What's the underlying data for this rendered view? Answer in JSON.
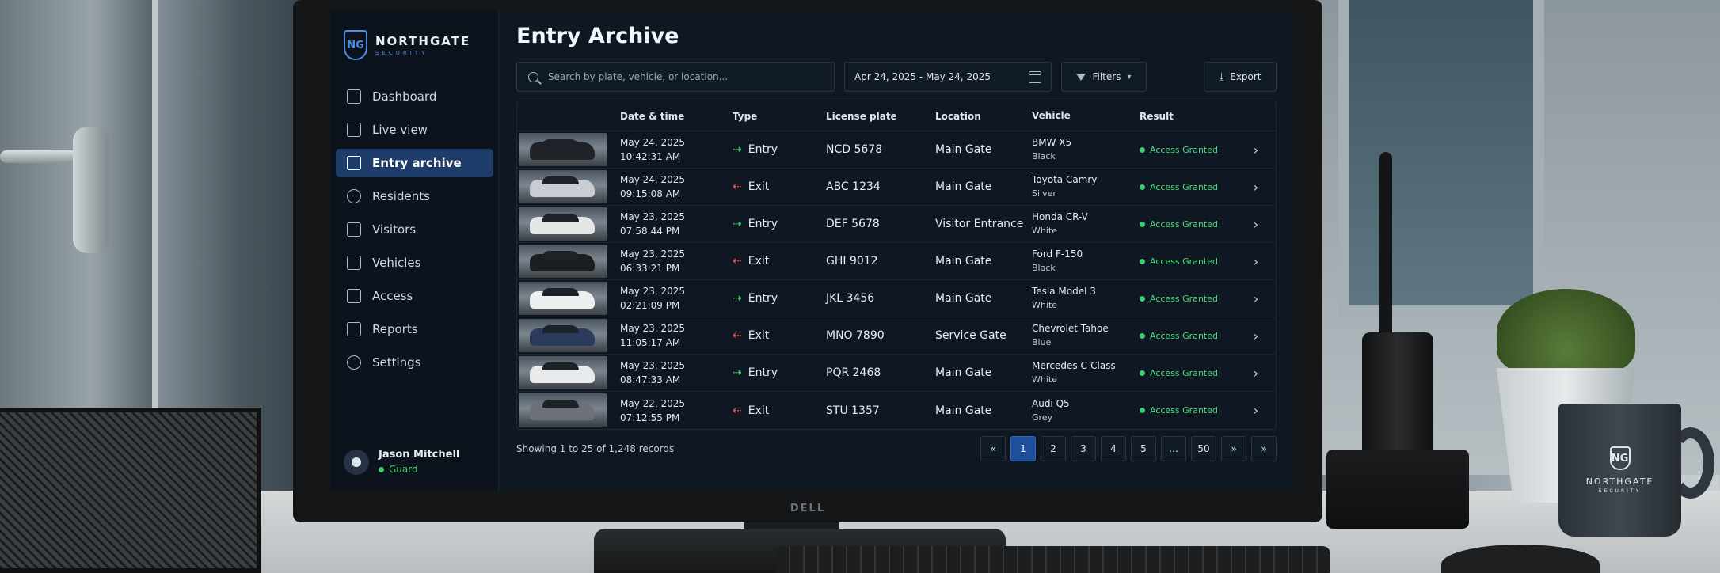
{
  "brand": {
    "name": "NORTHGATE",
    "sub": "SECURITY",
    "mark": "NG"
  },
  "page_title": "Entry Archive",
  "sidebar": {
    "items": [
      {
        "label": "Dashboard",
        "icon": "dashboard-icon",
        "active": false
      },
      {
        "label": "Live view",
        "icon": "camera-icon",
        "active": false
      },
      {
        "label": "Entry archive",
        "icon": "archive-icon",
        "active": true
      },
      {
        "label": "Residents",
        "icon": "person-icon",
        "active": false
      },
      {
        "label": "Visitors",
        "icon": "visitors-icon",
        "active": false
      },
      {
        "label": "Vehicles",
        "icon": "vehicle-icon",
        "active": false
      },
      {
        "label": "Access",
        "icon": "access-icon",
        "active": false
      },
      {
        "label": "Reports",
        "icon": "reports-icon",
        "active": false
      },
      {
        "label": "Settings",
        "icon": "gear-icon",
        "active": false
      }
    ]
  },
  "user": {
    "name": "Jason Mitchell",
    "role": "Guard"
  },
  "search": {
    "placeholder": "Search by plate, vehicle, or location..."
  },
  "date_range": "Apr 24, 2025 - May 24, 2025",
  "filters_label": "Filters",
  "export_label": "Export",
  "columns": {
    "datetime": "Date & time",
    "type": "Type",
    "plate": "License plate",
    "location": "Location",
    "vehicle": "Vehicle",
    "result": "Result"
  },
  "rows": [
    {
      "date": "May 24, 2025",
      "time": "10:42:31 AM",
      "type": "Entry",
      "plate": "NCD 5678",
      "location": "Main Gate",
      "vehicle": "BMW X5",
      "color": "Black",
      "result": "Access Granted",
      "car_color": "#1f2226"
    },
    {
      "date": "May 24, 2025",
      "time": "09:15:08 AM",
      "type": "Exit",
      "plate": "ABC 1234",
      "location": "Main Gate",
      "vehicle": "Toyota Camry",
      "color": "Silver",
      "result": "Access Granted",
      "car_color": "#c9cdd1"
    },
    {
      "date": "May 23, 2025",
      "time": "07:58:44 PM",
      "type": "Entry",
      "plate": "DEF 5678",
      "location": "Visitor Entrance",
      "vehicle": "Honda CR-V",
      "color": "White",
      "result": "Access Granted",
      "car_color": "#e4e6e8"
    },
    {
      "date": "May 23, 2025",
      "time": "06:33:21 PM",
      "type": "Exit",
      "plate": "GHI 9012",
      "location": "Main Gate",
      "vehicle": "Ford F-150",
      "color": "Black",
      "result": "Access Granted",
      "car_color": "#1c1e21"
    },
    {
      "date": "May 23, 2025",
      "time": "02:21:09 PM",
      "type": "Entry",
      "plate": "JKL 3456",
      "location": "Main Gate",
      "vehicle": "Tesla Model 3",
      "color": "White",
      "result": "Access Granted",
      "car_color": "#eceef0"
    },
    {
      "date": "May 23, 2025",
      "time": "11:05:17 AM",
      "type": "Exit",
      "plate": "MNO 7890",
      "location": "Service Gate",
      "vehicle": "Chevrolet Tahoe",
      "color": "Blue",
      "result": "Access Granted",
      "car_color": "#2a3b5c"
    },
    {
      "date": "May 23, 2025",
      "time": "08:47:33 AM",
      "type": "Entry",
      "plate": "PQR 2468",
      "location": "Main Gate",
      "vehicle": "Mercedes C-Class",
      "color": "White",
      "result": "Access Granted",
      "car_color": "#e8eaec"
    },
    {
      "date": "May 22, 2025",
      "time": "07:12:55 PM",
      "type": "Exit",
      "plate": "STU 1357",
      "location": "Main Gate",
      "vehicle": "Audi Q5",
      "color": "Grey",
      "result": "Access Granted",
      "car_color": "#6d7278"
    }
  ],
  "footer": {
    "count": "Showing 1 to 25 of 1,248 records"
  },
  "pagination": {
    "prev": "«",
    "pages": [
      "1",
      "2",
      "3",
      "4",
      "5",
      "...",
      "50"
    ],
    "next": "»",
    "last": "»"
  },
  "monitor_brand": "DELL",
  "mug": {
    "mark": "NG",
    "name": "NORTHGATE",
    "sub": "SECURITY"
  },
  "colors": {
    "entry": "#3fd46f",
    "exit": "#e5484d",
    "granted": "#4cd97a",
    "accent": "#1d3c6a"
  }
}
